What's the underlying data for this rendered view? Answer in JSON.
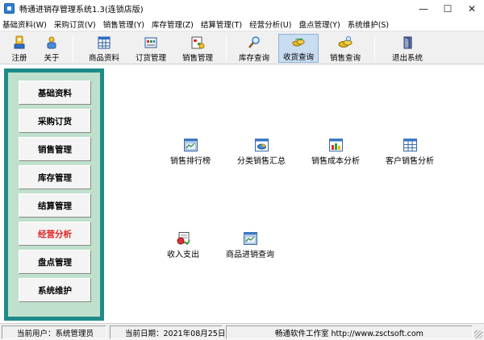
{
  "window": {
    "title": "畅通进销存管理系统1.3(连锁店版)",
    "controls": {
      "minimize": "—",
      "maximize": "☐",
      "close": "✕"
    }
  },
  "menubar": {
    "items": [
      {
        "label": "基础资料(W)"
      },
      {
        "label": "采购订货(V)"
      },
      {
        "label": "销售管理(Y)"
      },
      {
        "label": "库存管理(Z)"
      },
      {
        "label": "结算管理(T)"
      },
      {
        "label": "经营分析(U)"
      },
      {
        "label": "盘点管理(Y)"
      },
      {
        "label": "系统维护(S)"
      }
    ]
  },
  "toolbar": {
    "buttons": [
      {
        "label": "注册",
        "icon": "register-icon"
      },
      {
        "label": "关于",
        "icon": "about-icon"
      },
      {
        "label": "商品资料",
        "icon": "product-grid-icon"
      },
      {
        "label": "订货管理",
        "icon": "order-icon"
      },
      {
        "label": "销售管理",
        "icon": "sales-icon"
      },
      {
        "label": "库存查询",
        "icon": "stock-search-icon"
      },
      {
        "label": "收货查询",
        "icon": "receive-icon"
      },
      {
        "label": "销售查询",
        "icon": "sales-query-icon"
      },
      {
        "label": "退出系统",
        "icon": "exit-door-icon"
      }
    ],
    "active_index": 6
  },
  "sidebar": {
    "items": [
      {
        "label": "基础资料"
      },
      {
        "label": "采购订货"
      },
      {
        "label": "销售管理"
      },
      {
        "label": "库存管理"
      },
      {
        "label": "结算管理"
      },
      {
        "label": "经营分析"
      },
      {
        "label": "盘点管理"
      },
      {
        "label": "系统维护"
      }
    ],
    "active_index": 5,
    "active_color": "#e02020"
  },
  "main": {
    "functions": [
      {
        "label": "销售排行榜",
        "icon": "chart-window-icon"
      },
      {
        "label": "分类销售汇总",
        "icon": "category-summary-icon"
      },
      {
        "label": "销售成本分析",
        "icon": "bar-chart-icon"
      },
      {
        "label": "客户销售分析",
        "icon": "table-grid-icon"
      },
      {
        "label": "收入支出",
        "icon": "income-expense-icon"
      },
      {
        "label": "商品进销查询",
        "icon": "chart-window-icon"
      }
    ]
  },
  "statusbar": {
    "user": "当前用户：系统管理员",
    "date": "当前日期：2021年08月25日",
    "company": "畅通软件工作室 http://www.zsctsoft.com"
  }
}
